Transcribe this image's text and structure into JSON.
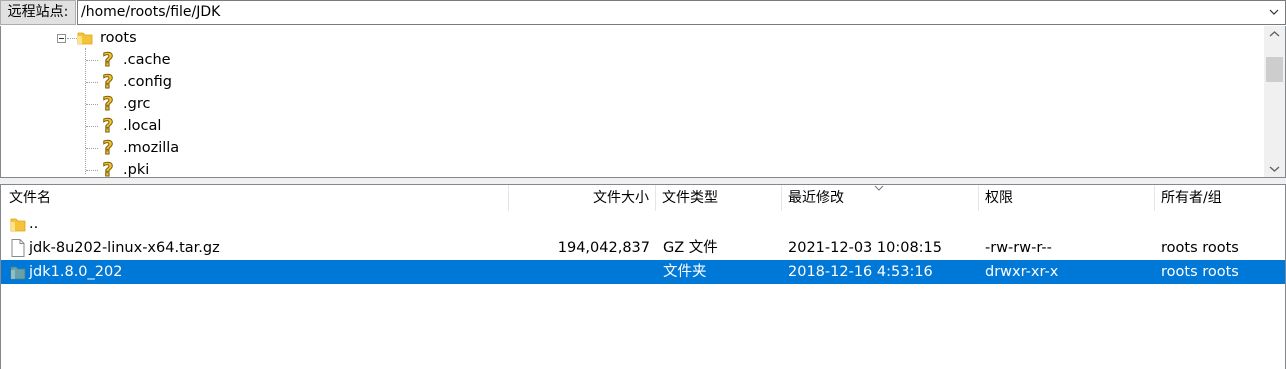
{
  "pathbar": {
    "label": "远程站点:",
    "path": "/home/roots/file/JDK"
  },
  "tree": {
    "root": {
      "label": "roots",
      "icon": "folder-icon"
    },
    "children": [
      {
        "label": ".cache",
        "icon": "unknown-folder-icon"
      },
      {
        "label": ".config",
        "icon": "unknown-folder-icon"
      },
      {
        "label": ".grc",
        "icon": "unknown-folder-icon"
      },
      {
        "label": ".local",
        "icon": "unknown-folder-icon"
      },
      {
        "label": ".mozilla",
        "icon": "unknown-folder-icon"
      },
      {
        "label": ".pki",
        "icon": "unknown-folder-icon"
      }
    ]
  },
  "list": {
    "headers": {
      "name": "文件名",
      "size": "文件大小",
      "type": "文件类型",
      "modified": "最近修改",
      "perms": "权限",
      "owner": "所有者/组"
    },
    "sorted_by": "modified",
    "rows": [
      {
        "name": "..",
        "size": "",
        "type": "",
        "modified": "",
        "perms": "",
        "owner": "",
        "icon": "folder-icon",
        "selected": false
      },
      {
        "name": "jdk-8u202-linux-x64.tar.gz",
        "size": "194,042,837",
        "type": "GZ 文件",
        "modified": "2021-12-03 10:08:15",
        "perms": "-rw-rw-r--",
        "owner": "roots roots",
        "icon": "file-icon",
        "selected": false
      },
      {
        "name": "jdk1.8.0_202",
        "size": "",
        "type": "文件夹",
        "modified": "2018-12-16 4:53:16",
        "perms": "drwxr-xr-x",
        "owner": "roots roots",
        "icon": "folder-icon",
        "selected": true
      }
    ]
  },
  "colors": {
    "selection": "#0078d7",
    "folder": "#f4c338",
    "border": "#828790"
  }
}
